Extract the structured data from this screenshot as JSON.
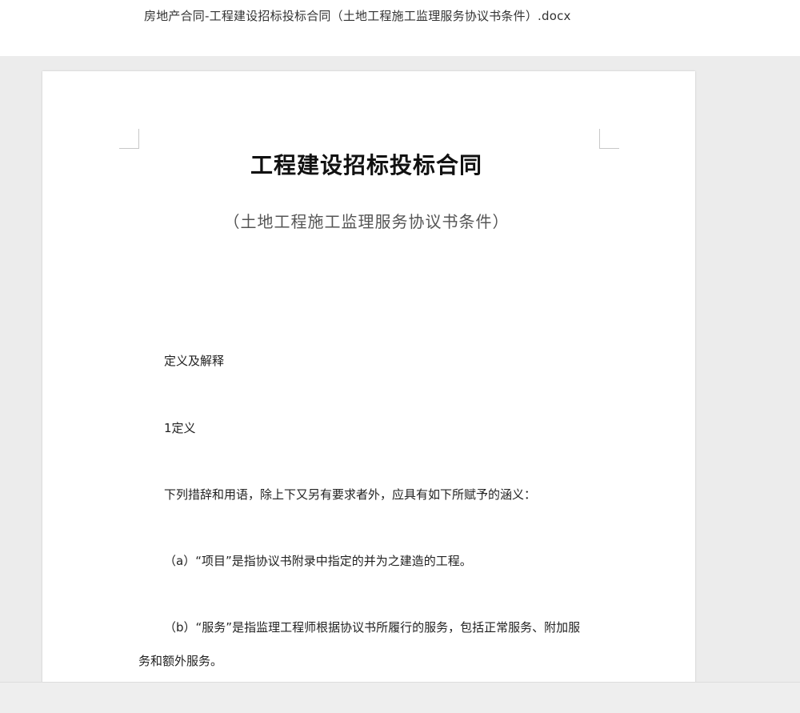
{
  "header": {
    "filename": "房地产合同-工程建设招标投标合同（土地工程施工监理服务协议书条件）.docx"
  },
  "document": {
    "title": "工程建设招标投标合同",
    "subtitle": "（土地工程施工监理服务协议书条件）",
    "paragraphs": [
      "定义及解释",
      "1定义",
      "下列措辞和用语，除上下又另有要求者外，应具有如下所赋予的涵义：",
      "（a）“项目”是指协议书附录中指定的并为之建造的工程。",
      "（b）“服务”是指监理工程师根据协议书所履行的服务，包括正常服务、附加服",
      "务和额外服务。"
    ]
  }
}
